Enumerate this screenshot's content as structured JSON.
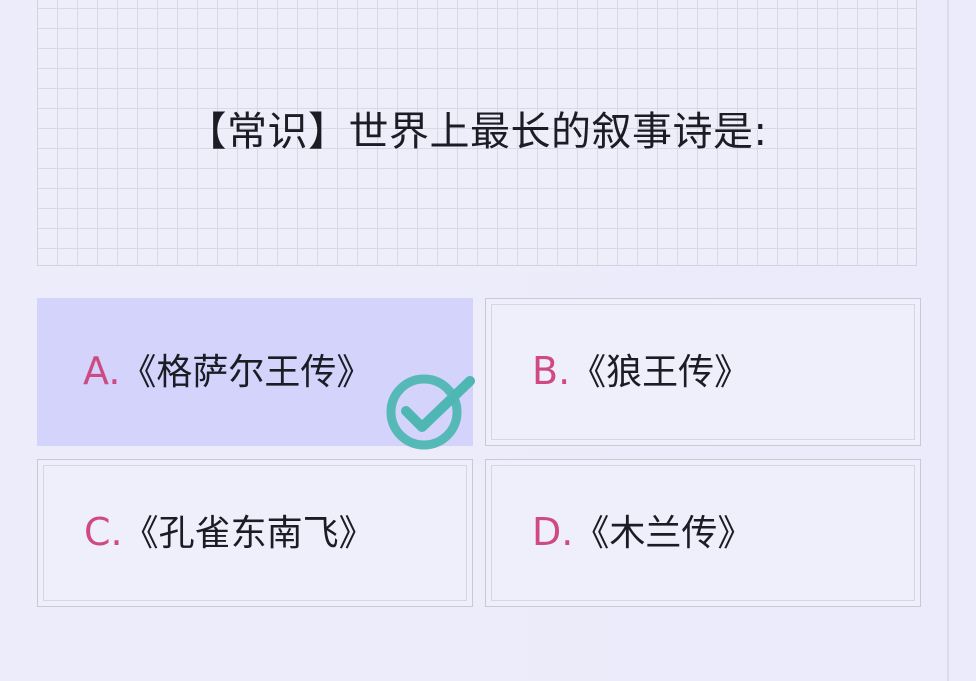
{
  "question": {
    "text": "【常识】世界上最长的叙事诗是:"
  },
  "options": [
    {
      "letter": "A.",
      "text": "《格萨尔王传》",
      "state": "selected"
    },
    {
      "letter": "B.",
      "text": "《狼王传》",
      "state": "normal"
    },
    {
      "letter": "C.",
      "text": "《孔雀东南飞》",
      "state": "normal"
    },
    {
      "letter": "D.",
      "text": "《木兰传》",
      "state": "normal"
    }
  ],
  "indicator": {
    "icon": "checkmark-circle-icon",
    "color": "#4fb7b3"
  },
  "colors": {
    "background": "#ececfb",
    "selected_option": "#d3d3fb",
    "option_letter": "#d04a82",
    "text": "#1c1c24"
  }
}
